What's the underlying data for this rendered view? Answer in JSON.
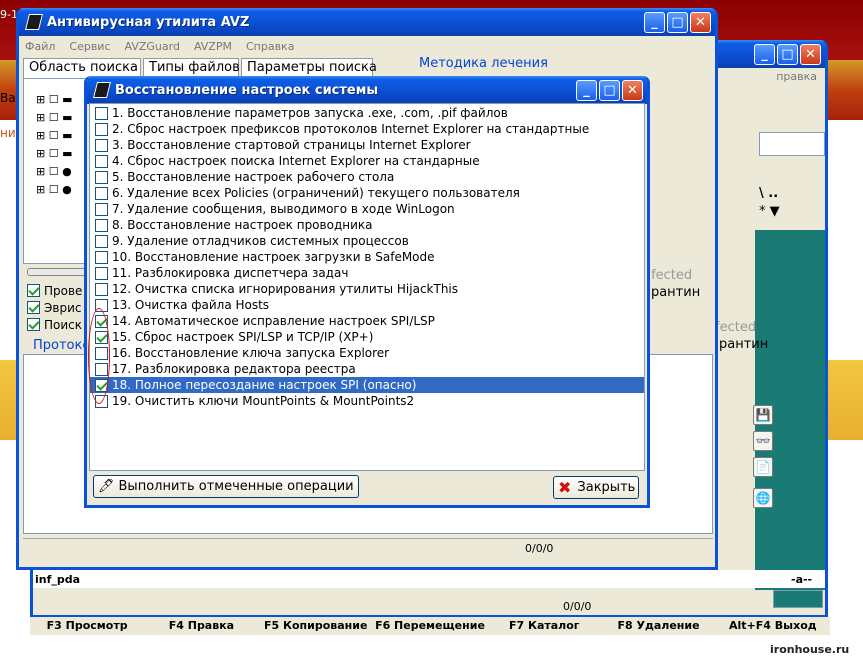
{
  "background": {
    "corner_text": "9-1",
    "left_fragment": "Ва",
    "left_fragment2": "ни"
  },
  "main_window": {
    "title": "Антивирусная утилита AVZ",
    "menu": [
      "Файл",
      "Сервис",
      "AVZGuard",
      "AVZPM",
      "Справка"
    ],
    "tabs": [
      "Область поиска",
      "Типы файлов",
      "Параметры поиска"
    ],
    "method_label": "Методика лечения",
    "checks": [
      {
        "label": "Прове",
        "checked": true
      },
      {
        "label": "Эврис",
        "checked": true
      },
      {
        "label": "Поиск",
        "checked": true
      }
    ],
    "protocol_label": "Протоко",
    "status": "0/0/0",
    "infected": "Infected",
    "quarantine": "арантин"
  },
  "second_window": {
    "menu_fragment": "правка",
    "infected": "fected",
    "quarantine": "рантин",
    "status": "0/0/0",
    "file_fragment": "inf_pda",
    "combo_fragment": "-a--"
  },
  "dialog": {
    "title": "Восстановление настроек системы",
    "items": [
      {
        "label": "1. Восстановление параметров запуска .exe, .com, .pif файлов",
        "checked": false,
        "selected": false
      },
      {
        "label": "2. Сброс настроек префиксов протоколов Internet Explorer на стандартные",
        "checked": false,
        "selected": false
      },
      {
        "label": "3. Восстановление стартовой страницы Internet Explorer",
        "checked": false,
        "selected": false
      },
      {
        "label": "4. Сброс настроек поиска Internet Explorer на стандарные",
        "checked": false,
        "selected": false
      },
      {
        "label": "5. Восстановление настроек рабочего стола",
        "checked": false,
        "selected": false
      },
      {
        "label": "6. Удаление всех Policies (ограничений) текущего пользователя",
        "checked": false,
        "selected": false
      },
      {
        "label": "7. Удаление сообщения, выводимого в ходе WinLogon",
        "checked": false,
        "selected": false
      },
      {
        "label": "8. Восстановление настроек проводника",
        "checked": false,
        "selected": false
      },
      {
        "label": "9. Удаление отладчиков системных процессов",
        "checked": false,
        "selected": false
      },
      {
        "label": "10. Восстановление настроек загрузки в SafeMode",
        "checked": false,
        "selected": false
      },
      {
        "label": "11. Разблокировка диспетчера задач",
        "checked": false,
        "selected": false
      },
      {
        "label": "12. Очистка списка игнорирования утилиты HijackThis",
        "checked": false,
        "selected": false
      },
      {
        "label": "13. Очистка файла Hosts",
        "checked": false,
        "selected": false
      },
      {
        "label": "14. Автоматическое исправление настроек SPI/LSP",
        "checked": true,
        "selected": false
      },
      {
        "label": "15. Сброс настроек SPI/LSP и TCP/IP (XP+)",
        "checked": true,
        "selected": false
      },
      {
        "label": "16. Восстановление ключа запуска Explorer",
        "checked": false,
        "selected": false
      },
      {
        "label": "17. Разблокировка редактора реестра",
        "checked": false,
        "selected": false
      },
      {
        "label": "18. Полное пересоздание настроек SPI (опасно)",
        "checked": true,
        "selected": true
      },
      {
        "label": "19. Очистить ключи MountPoints & MountPoints2",
        "checked": false,
        "selected": false
      }
    ],
    "execute_label": "Выполнить отмеченные операции",
    "close_label": "Закрыть"
  },
  "function_keys": [
    "F3 Просмотр",
    "F4 Правка",
    "F5 Копирование",
    "F6 Перемещение",
    "F7 Каталог",
    "F8 Удаление",
    "Alt+F4 Выход"
  ],
  "watermark": "ironhouse.ru",
  "colors": {
    "titlebar": "#0a4ed0",
    "selection": "#316ac5",
    "annotation": "#e01010"
  }
}
